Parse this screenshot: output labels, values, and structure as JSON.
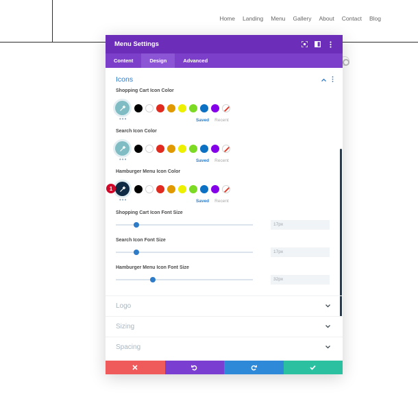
{
  "site": {
    "nav": [
      "Home",
      "Landing",
      "Menu",
      "Gallery",
      "About",
      "Contact",
      "Blog"
    ]
  },
  "modal": {
    "title": "Menu Settings",
    "tabs": [
      {
        "label": "Content",
        "active": false
      },
      {
        "label": "Design",
        "active": true
      },
      {
        "label": "Advanced",
        "active": false
      }
    ],
    "section_title": "Icons",
    "color_fields": [
      {
        "label": "Shopping Cart Icon Color",
        "picker_color": "#7fbcc3",
        "saved": "Saved",
        "recent": "Recent"
      },
      {
        "label": "Search Icon Color",
        "picker_color": "#7fbcc3",
        "saved": "Saved",
        "recent": "Recent"
      },
      {
        "label": "Hamburger Menu Icon Color",
        "picker_color": "#0e2a44",
        "saved": "Saved",
        "recent": "Recent"
      }
    ],
    "swatch_colors": [
      "#000000",
      "#ffffff",
      "#e02b20",
      "#e09900",
      "#edf000",
      "#7cda24",
      "#0c71c3",
      "#8300e9"
    ],
    "size_fields": [
      {
        "label": "Shopping Cart Icon Font Size",
        "value": "17px",
        "fraction": 0.15
      },
      {
        "label": "Search Icon Font Size",
        "value": "17px",
        "fraction": 0.15
      },
      {
        "label": "Hamburger Menu Icon Font Size",
        "value": "32px",
        "fraction": 0.27
      }
    ],
    "collapsed_sections": [
      "Logo",
      "Sizing",
      "Spacing"
    ]
  },
  "footer": {
    "colors": [
      "#ef5a5a",
      "#7a3ed0",
      "#2e8ad8",
      "#2bc0a0"
    ]
  },
  "badge": "1",
  "icons": {
    "fullscreen": "fullscreen-icon",
    "split": "split-view-icon",
    "kebab": "kebab-icon",
    "eyedropper": "eyedropper-icon"
  }
}
